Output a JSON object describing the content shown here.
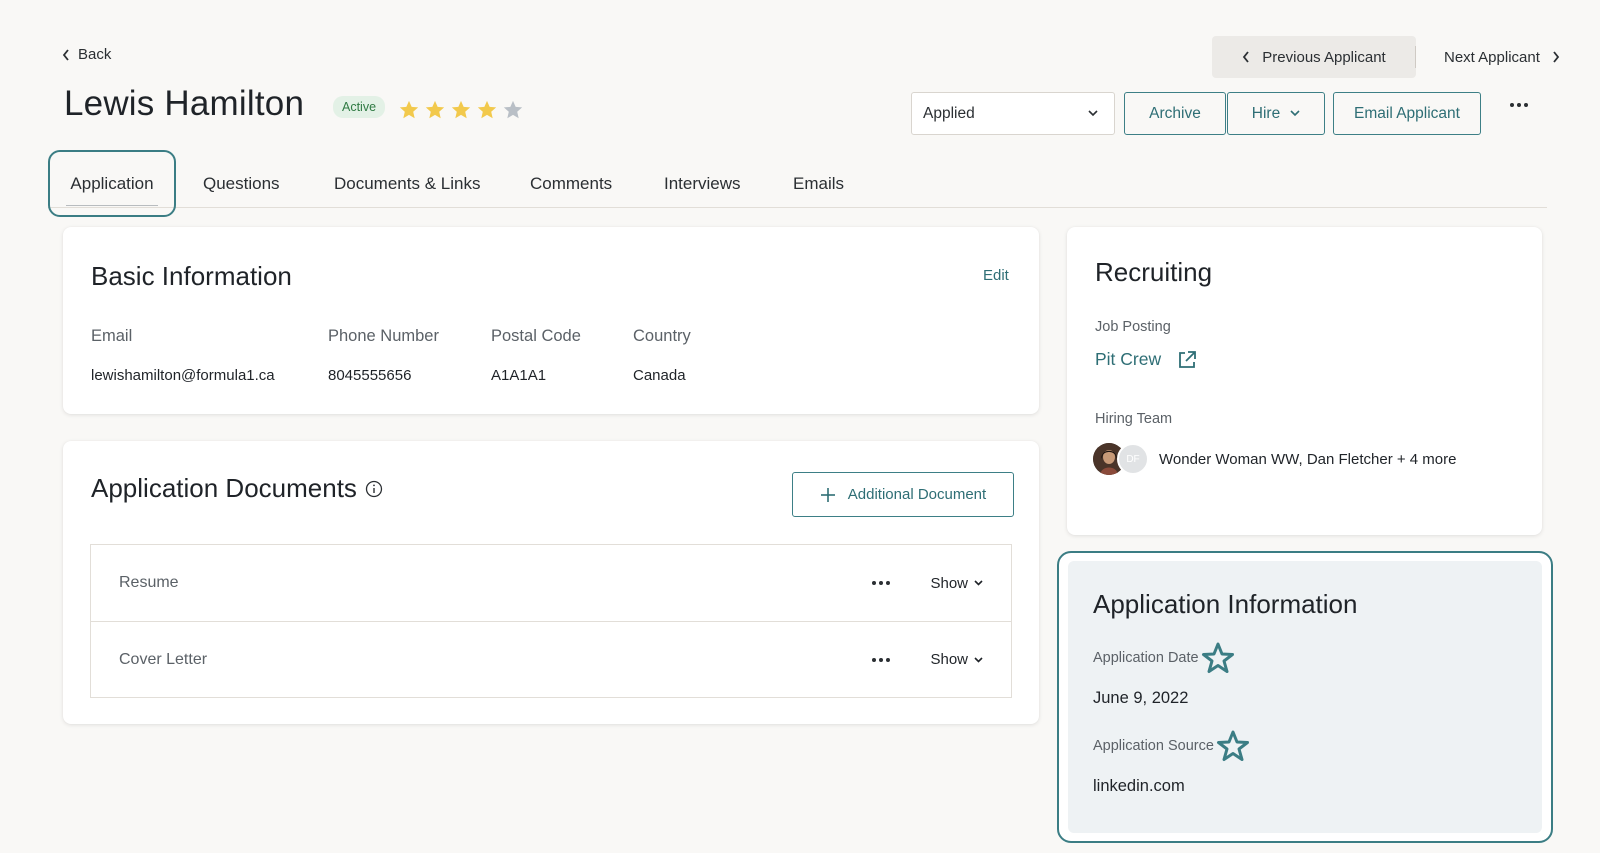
{
  "nav": {
    "back_label": "Back",
    "prev_label": "Previous Applicant",
    "next_label": "Next Applicant"
  },
  "applicant": {
    "name": "Lewis Hamilton",
    "status_badge": "Active",
    "rating": 4,
    "rating_max": 5
  },
  "actions": {
    "stage_select": "Applied",
    "archive_label": "Archive",
    "hire_label": "Hire",
    "email_label": "Email Applicant"
  },
  "tabs": [
    {
      "label": "Application"
    },
    {
      "label": "Questions"
    },
    {
      "label": "Documents & Links"
    },
    {
      "label": "Comments"
    },
    {
      "label": "Interviews"
    },
    {
      "label": "Emails"
    }
  ],
  "basic_info": {
    "title": "Basic Information",
    "edit_label": "Edit",
    "fields": [
      {
        "label": "Email",
        "value": "lewishamilton@formula1.ca"
      },
      {
        "label": "Phone Number",
        "value": "8045555656"
      },
      {
        "label": "Postal Code",
        "value": "A1A1A1"
      },
      {
        "label": "Country",
        "value": "Canada"
      }
    ]
  },
  "documents": {
    "title": "Application Documents",
    "add_label": "Additional Document",
    "rows": [
      {
        "name": "Resume",
        "show_label": "Show"
      },
      {
        "name": "Cover Letter",
        "show_label": "Show"
      }
    ]
  },
  "recruiting": {
    "title": "Recruiting",
    "job_posting_label": "Job Posting",
    "job_posting_value": "Pit Crew",
    "hiring_team_label": "Hiring Team",
    "hiring_team_value": "Wonder Woman WW, Dan Fletcher + 4 more",
    "avatar_initials": "DF"
  },
  "application_info": {
    "title": "Application Information",
    "date_label": "Application Date",
    "date_value": "June 9, 2022",
    "source_label": "Application Source",
    "source_value": "linkedin.com"
  },
  "colors": {
    "accent": "#3b7d84",
    "star_filled": "#f2c94c",
    "star_empty": "#b9bfc6",
    "badge_bg": "#e3f1e6",
    "badge_text": "#2f7a43"
  }
}
